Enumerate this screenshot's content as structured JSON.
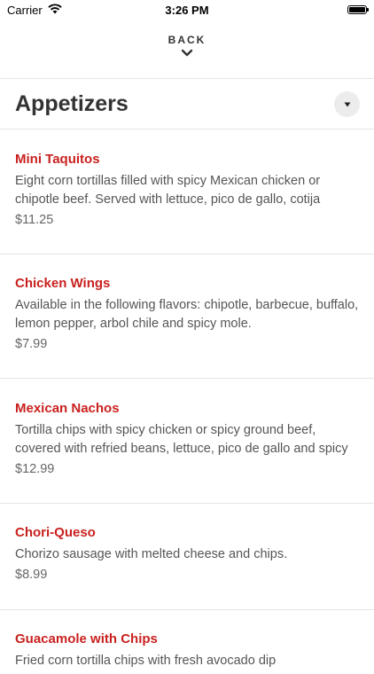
{
  "status_bar": {
    "carrier": "Carrier",
    "time": "3:26 PM"
  },
  "nav": {
    "back_label": "BACK"
  },
  "section": {
    "title": "Appetizers"
  },
  "items": [
    {
      "name": "Mini Taquitos",
      "description": "Eight corn tortillas filled with spicy Mexican chicken or chipotle beef. Served with lettuce, pico de gallo, cotija",
      "price": "$11.25"
    },
    {
      "name": "Chicken Wings",
      "description": "Available in the following flavors: chipotle, barbecue, buffalo, lemon pepper, arbol chile and spicy mole.",
      "price": "$7.99"
    },
    {
      "name": "Mexican Nachos",
      "description": "Tortilla chips with spicy chicken or spicy ground beef, covered with refried beans, lettuce, pico de gallo and spicy",
      "price": "$12.99"
    },
    {
      "name": "Chori-Queso",
      "description": "Chorizo sausage with melted cheese and chips.",
      "price": "$8.99"
    },
    {
      "name": "Guacamole with Chips",
      "description": "Fried corn tortilla chips with fresh avocado dip",
      "price": ""
    }
  ],
  "colors": {
    "accent": "#c8211f",
    "divider": "#e5e5e5",
    "dropdown_bg": "#ececec"
  },
  "icons": {
    "wifi": "wifi-icon",
    "battery": "battery-icon",
    "back": "chevron-down-icon",
    "dropdown": "caret-down-icon"
  }
}
